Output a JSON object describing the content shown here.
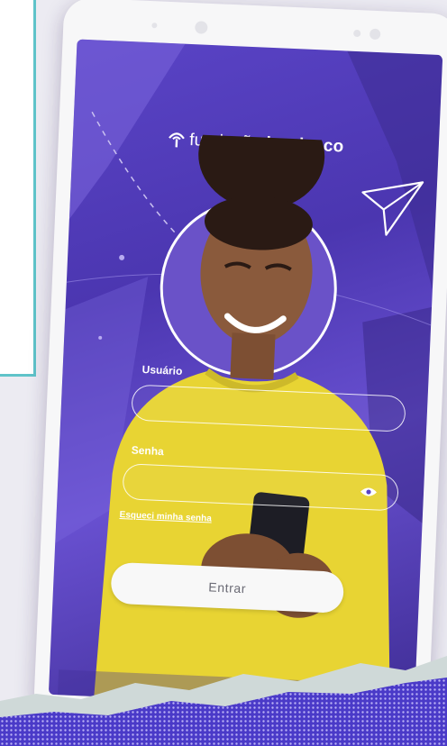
{
  "brand": {
    "name_light": "fundação",
    "name_bold": "bradesco"
  },
  "login": {
    "user_label": "Usuário",
    "user_value": "",
    "password_label": "Senha",
    "password_value": "",
    "forgot_label": "Esqueci minha senha",
    "submit_label": "Entrar"
  },
  "icons": [
    "tree-logo-icon",
    "paper-plane-icon",
    "eye-icon"
  ],
  "colors": {
    "screen": "#5a44c6",
    "sweater": "#e8d433",
    "accent_teal": "#5fc3c9"
  }
}
